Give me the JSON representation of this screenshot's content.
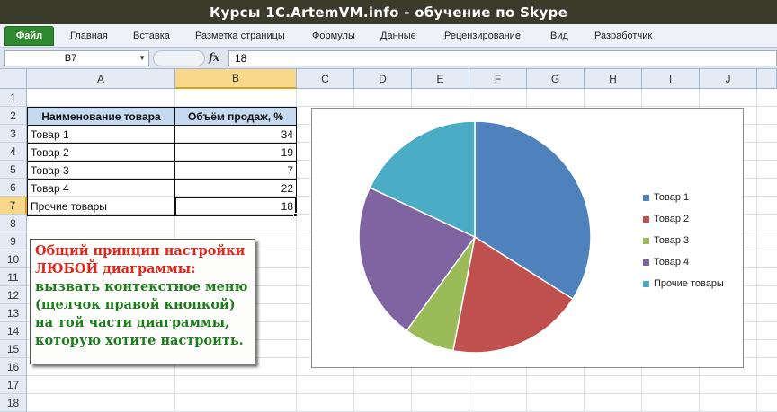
{
  "window": {
    "title": "Курсы 1C.ArtemVM.info - обучение по Skype"
  },
  "ribbon": {
    "file_tab": "Файл",
    "tabs": [
      "Главная",
      "Вставка",
      "Разметка страницы",
      "Формулы",
      "Данные",
      "Рецензирование",
      "Вид",
      "Разработчик"
    ]
  },
  "formula_bar": {
    "name_box": "B7",
    "fx_label": "fx",
    "formula_value": "18"
  },
  "sheet": {
    "columns": [
      "A",
      "B",
      "C",
      "D",
      "E",
      "F",
      "G",
      "H",
      "I",
      "J"
    ],
    "rows": [
      "1",
      "2",
      "3",
      "4",
      "5",
      "6",
      "7",
      "8",
      "9",
      "10",
      "11",
      "12",
      "13",
      "14",
      "15",
      "16",
      "17",
      "18"
    ],
    "table": {
      "headers": [
        "Наименование товара",
        "Объём продаж, %"
      ],
      "rows": [
        {
          "name": "Товар 1",
          "value": "34"
        },
        {
          "name": "Товар 2",
          "value": "19"
        },
        {
          "name": "Товар 3",
          "value": "7"
        },
        {
          "name": "Товар 4",
          "value": "22"
        },
        {
          "name": "Прочие товары",
          "value": "18"
        }
      ]
    },
    "active_cell": "B7"
  },
  "note": {
    "line1": "Общий принцип настройки",
    "line2": "ЛЮБОЙ диаграммы:",
    "line3": "вызвать контекстное меню",
    "line4": "(щелчок правой кнопкой)",
    "line5": "на той части диаграммы,",
    "line6": "которую хотите настроить.",
    "colors": {
      "heading": "#e0271e",
      "body": "#1f7a1f"
    }
  },
  "chart_data": {
    "type": "pie",
    "categories": [
      "Товар 1",
      "Товар 2",
      "Товар 3",
      "Товар 4",
      "Прочие товары"
    ],
    "values": [
      34,
      19,
      7,
      22,
      18
    ],
    "colors": [
      "#4f81bd",
      "#c0504d",
      "#9bbb59",
      "#8064a2",
      "#4bacc6"
    ],
    "legend_position": "right"
  }
}
